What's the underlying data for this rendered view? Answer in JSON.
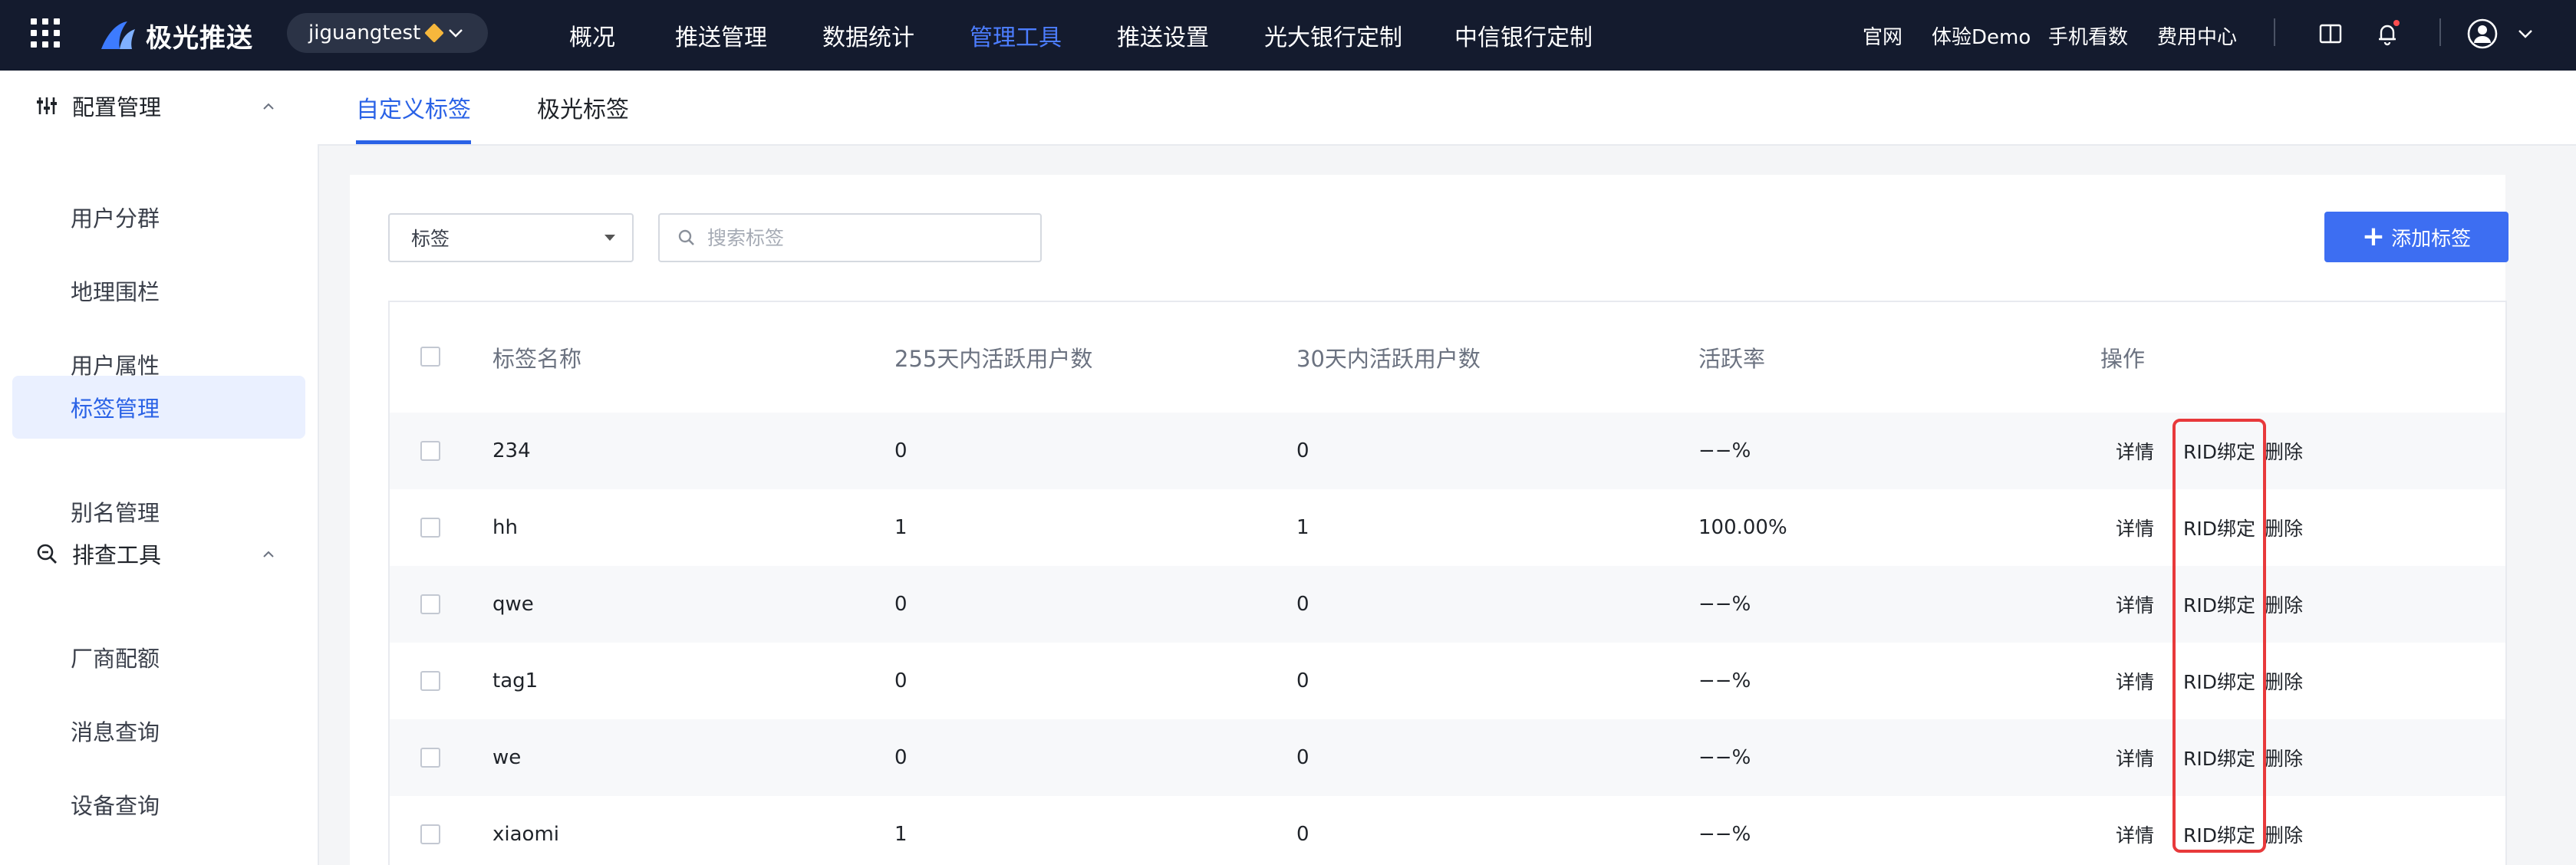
{
  "brand": {
    "name": "极光推送"
  },
  "app_switcher": {
    "label": "jiguangtest"
  },
  "nav": [
    "概况",
    "推送管理",
    "数据统计",
    "管理工具",
    "推送设置",
    "光大银行定制",
    "中信银行定制"
  ],
  "nav_active": "管理工具",
  "top_links": [
    "官网",
    "体验Demo",
    "手机看数",
    "费用中心"
  ],
  "sidebar": {
    "group1": {
      "label": "配置管理",
      "items": [
        "用户分群",
        "地理围栏",
        "用户属性",
        "标签管理",
        "别名管理"
      ]
    },
    "group2": {
      "label": "排查工具",
      "items": [
        "厂商配额",
        "消息查询",
        "设备查询"
      ]
    },
    "active_item": "标签管理"
  },
  "tabs": [
    "自定义标签",
    "极光标签"
  ],
  "filter": {
    "select_value": "标签",
    "search_placeholder": "搜索标签"
  },
  "add_button": "添加标签",
  "table": {
    "headers": [
      "标签名称",
      "255天内活跃用户数",
      "30天内活跃用户数",
      "活跃率",
      "操作"
    ],
    "rows": [
      {
        "name": "234",
        "active255": "0",
        "active30": "0",
        "rate": "−−%"
      },
      {
        "name": "hh",
        "active255": "1",
        "active30": "1",
        "rate": "100.00%"
      },
      {
        "name": "qwe",
        "active255": "0",
        "active30": "0",
        "rate": "−−%"
      },
      {
        "name": "tag1",
        "active255": "0",
        "active30": "0",
        "rate": "−−%"
      },
      {
        "name": "we",
        "active255": "0",
        "active30": "0",
        "rate": "−−%"
      },
      {
        "name": "xiaomi",
        "active255": "1",
        "active30": "0",
        "rate": "−−%"
      }
    ],
    "actions": [
      "详情",
      "RID绑定",
      "删除"
    ]
  },
  "colors": {
    "topbar": "#141b2e",
    "accent": "#2a62e6",
    "nav_active": "#4c7dff",
    "highlight": "#e8393b"
  }
}
